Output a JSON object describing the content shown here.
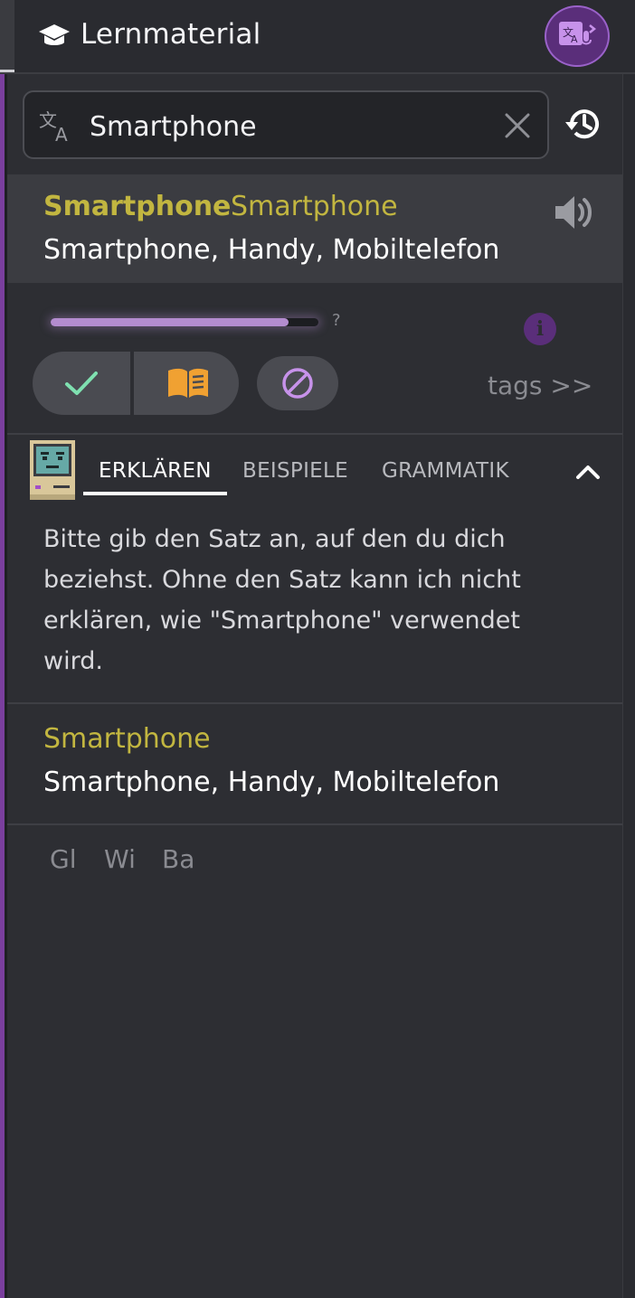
{
  "header": {
    "title": "Lernmaterial",
    "icon": "graduation-cap-icon",
    "translate_button_icon": "translate-icon"
  },
  "search": {
    "value": "Smartphone",
    "placeholder": "",
    "lang_icon": "translate-icon",
    "clear_icon": "close-icon",
    "history_icon": "history-icon"
  },
  "result": {
    "word_bold": "Smartphone",
    "word": "Smartphone",
    "translation": "Smartphone, Handy, Mobiltelefon",
    "speaker_icon": "speaker-icon"
  },
  "progress": {
    "level": 0.89,
    "help": "?",
    "info_icon": "info-icon",
    "accent": "#b48ccf"
  },
  "actions": {
    "known_icon": "checkmark-icon",
    "learn_icon": "open-book-icon",
    "ignore_icon": "block-icon",
    "tags_label": "tags >>"
  },
  "ai": {
    "avatar_icon": "retro-computer-avatar",
    "tabs": [
      {
        "label": "ERKLÄREN",
        "active": true
      },
      {
        "label": "BEISPIELE",
        "active": false
      },
      {
        "label": "GRAMMATIK",
        "active": false
      }
    ],
    "collapse_icon": "chevron-up-icon",
    "explanation": "Bitte gib den Satz an, auf den du dich beziehst. Ohne den Satz kann ich nicht erklären, wie \"Smartphone\" verwendet wird."
  },
  "entry": {
    "word": "Smartphone",
    "translation": "Smartphone, Handy, Mobiltelefon"
  },
  "external_links": [
    "Gl",
    "Wi",
    "Ba"
  ],
  "colors": {
    "background": "#2d2e33",
    "word_highlight": "#c2b640",
    "accent_purple": "#7a3f9e",
    "learn_orange": "#f0a132",
    "known_green": "#7fe0b0"
  }
}
